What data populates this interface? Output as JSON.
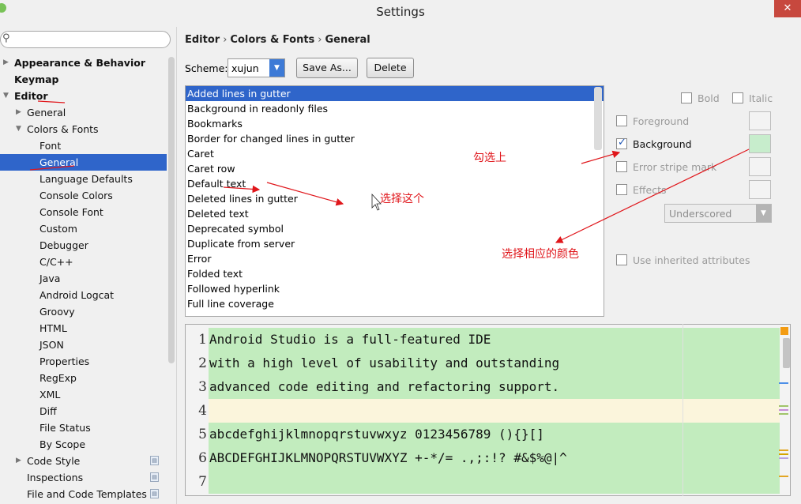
{
  "window": {
    "title": "Settings",
    "close_glyph": "✕"
  },
  "sidebar": {
    "search_placeholder": "",
    "items": [
      {
        "label": "Appearance & Behavior",
        "level": 0,
        "arrow": "▶",
        "bold": true
      },
      {
        "label": "Keymap",
        "level": 0,
        "arrow": "",
        "bold": true
      },
      {
        "label": "Editor",
        "level": 0,
        "arrow": "▼",
        "bold": true
      },
      {
        "label": "General",
        "level": 1,
        "arrow": "▶"
      },
      {
        "label": "Colors & Fonts",
        "level": 1,
        "arrow": "▼"
      },
      {
        "label": "Font",
        "level": 2
      },
      {
        "label": "General",
        "level": 2,
        "selected": true
      },
      {
        "label": "Language Defaults",
        "level": 2
      },
      {
        "label": "Console Colors",
        "level": 2
      },
      {
        "label": "Console Font",
        "level": 2
      },
      {
        "label": "Custom",
        "level": 2
      },
      {
        "label": "Debugger",
        "level": 2
      },
      {
        "label": "C/C++",
        "level": 2
      },
      {
        "label": "Java",
        "level": 2
      },
      {
        "label": "Android Logcat",
        "level": 2
      },
      {
        "label": "Groovy",
        "level": 2
      },
      {
        "label": "HTML",
        "level": 2
      },
      {
        "label": "JSON",
        "level": 2
      },
      {
        "label": "Properties",
        "level": 2
      },
      {
        "label": "RegExp",
        "level": 2
      },
      {
        "label": "XML",
        "level": 2
      },
      {
        "label": "Diff",
        "level": 2
      },
      {
        "label": "File Status",
        "level": 2
      },
      {
        "label": "By Scope",
        "level": 2
      },
      {
        "label": "Code Style",
        "level": 1,
        "arrow": "▶",
        "project_icon": true
      },
      {
        "label": "Inspections",
        "level": 1,
        "project_icon": true
      },
      {
        "label": "File and Code Templates",
        "level": 1,
        "project_icon": true
      }
    ]
  },
  "breadcrumb": [
    "Editor",
    "Colors & Fonts",
    "General"
  ],
  "scheme": {
    "label": "Scheme:",
    "value": "xujun",
    "save_as_label": "Save As...",
    "delete_label": "Delete"
  },
  "attribute_list": [
    "Added lines in gutter",
    "Background in readonly files",
    "Bookmarks",
    "Border for changed lines in gutter",
    "Caret",
    "Caret row",
    "Default text",
    "Deleted lines in gutter",
    "Deleted text",
    "Deprecated symbol",
    "Duplicate from server",
    "Error",
    "Folded text",
    "Followed hyperlink",
    "Full line coverage"
  ],
  "attribute_selected_index": 0,
  "attributes_panel": {
    "bold_label": "Bold",
    "italic_label": "Italic",
    "foreground_label": "Foreground",
    "background_label": "Background",
    "error_stripe_label": "Error stripe mark",
    "effects_label": "Effects",
    "effect_type": "Underscored",
    "inherited_label": "Use inherited attributes",
    "background_checked": true,
    "background_color": "#c7edcc"
  },
  "preview": {
    "lines": [
      {
        "num": "1",
        "text": "Android Studio is a full-featured IDE"
      },
      {
        "num": "2",
        "text": "with a high level of usability and outstanding"
      },
      {
        "num": "3",
        "text": "advanced code editing and refactoring support."
      },
      {
        "num": "4",
        "text": ""
      },
      {
        "num": "5",
        "text": "abcdefghijklmnopqrstuvwxyz 0123456789 (){}[]"
      },
      {
        "num": "6",
        "text": "ABCDEFGHIJKLMNOPQRSTUVWXYZ +-*/= .,;:!? #&$%@|^"
      },
      {
        "num": "7",
        "text": ""
      }
    ],
    "caret_line_index": 3,
    "highlight_color": "#c2ecbe",
    "caret_row_color": "#fbf5dc"
  },
  "annotations": {
    "check_it": "勾选上",
    "choose_this": "选择这个",
    "choose_color": "选择相应的颜色",
    "color": "#e0161b"
  }
}
